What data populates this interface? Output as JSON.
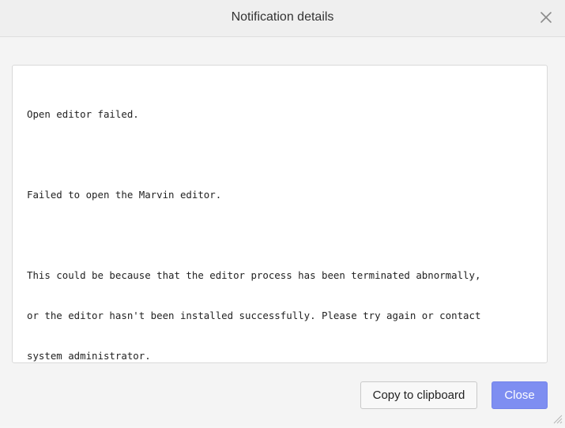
{
  "dialog": {
    "title": "Notification details",
    "close_icon": "close-icon"
  },
  "message": {
    "lines": [
      "Open editor failed.",
      "",
      "Failed to open the Marvin editor.",
      "",
      "This could be because that the editor process has been terminated abnormally,",
      "or the editor hasn't been installed successfully. Please try again or contact",
      "system administrator."
    ]
  },
  "buttons": {
    "copy_label": "Copy to clipboard",
    "close_label": "Close"
  },
  "colors": {
    "primary": "#7e8ef1",
    "header_bg": "#efefef",
    "dialog_bg": "#f4f4f4"
  }
}
